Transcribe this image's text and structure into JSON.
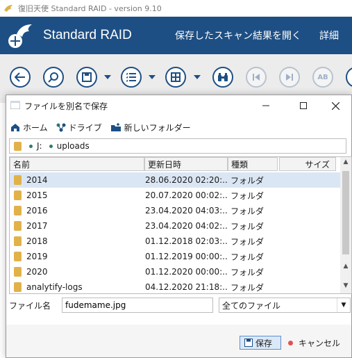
{
  "app": {
    "title": "復旧天使 Standard RAID - version 9.10"
  },
  "header": {
    "brand": "Standard RAID",
    "nav": [
      "保存したスキャン結果を開く",
      "詳細"
    ]
  },
  "toolbar": {
    "buttons": [
      "back-icon",
      "search-icon",
      "save-icon",
      "list-icon",
      "grid-icon",
      "binoculars-icon",
      "prev-icon",
      "next-icon",
      "ab-icon"
    ]
  },
  "dialog": {
    "title": "ファイルを別名で保存",
    "nav": {
      "home": "ホーム",
      "drive": "ドライブ",
      "new_folder": "新しいフォルダー"
    },
    "path": {
      "drive": "J:",
      "folder": "uploads"
    },
    "columns": {
      "name": "名前",
      "modified": "更新日時",
      "type": "種類",
      "size": "サイズ"
    },
    "rows": [
      {
        "name": "2014",
        "date": "28.06.2020 02:20:...",
        "type": "フォルダ"
      },
      {
        "name": "2015",
        "date": "20.07.2020 00:02:...",
        "type": "フォルダ"
      },
      {
        "name": "2016",
        "date": "23.04.2020 04:03:...",
        "type": "フォルダ"
      },
      {
        "name": "2017",
        "date": "23.04.2020 04:02:...",
        "type": "フォルダ"
      },
      {
        "name": "2018",
        "date": "01.12.2018 02:03:...",
        "type": "フォルダ"
      },
      {
        "name": "2019",
        "date": "01.12.2019 00:00:...",
        "type": "フォルダ"
      },
      {
        "name": "2020",
        "date": "01.12.2020 00:00:...",
        "type": "フォルダ"
      },
      {
        "name": "analytify-logs",
        "date": "04.12.2020 21:18:...",
        "type": "フォルダ"
      }
    ],
    "filename_label": "ファイル名",
    "filename_value": "fudemame.jpg",
    "filetype_value": "全てのファイル",
    "save_label": "保存",
    "cancel_label": "キャンセル"
  }
}
